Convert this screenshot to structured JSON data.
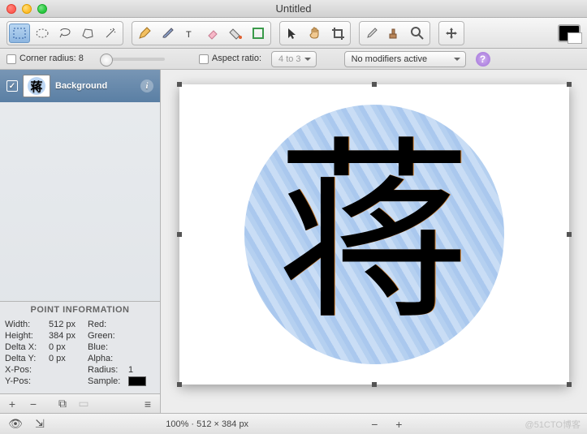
{
  "window": {
    "title": "Untitled"
  },
  "options": {
    "corner_radius_label": "Corner radius:",
    "corner_radius_value": "8",
    "aspect_ratio_label": "Aspect ratio:",
    "aspect_ratio_value": "4 to 3",
    "modifiers_value": "No modifiers active",
    "help_glyph": "?"
  },
  "sidebar": {
    "layer": {
      "name": "Background",
      "thumb_char": "蒋",
      "info_glyph": "i"
    },
    "point_info": {
      "title": "POINT INFORMATION",
      "rows": [
        {
          "k1": "Width:",
          "v1": "512 px",
          "k2": "Red:",
          "v2": ""
        },
        {
          "k1": "Height:",
          "v1": "384 px",
          "k2": "Green:",
          "v2": ""
        },
        {
          "k1": "Delta X:",
          "v1": "0 px",
          "k2": "Blue:",
          "v2": ""
        },
        {
          "k1": "Delta Y:",
          "v1": "0 px",
          "k2": "Alpha:",
          "v2": ""
        },
        {
          "k1": "X-Pos:",
          "v1": "",
          "k2": "Radius:",
          "v2": "1"
        },
        {
          "k1": "Y-Pos:",
          "v1": "",
          "k2": "Sample:",
          "v2": ""
        }
      ]
    }
  },
  "canvas": {
    "glyph": "蒋"
  },
  "status": {
    "zoom_text": "100% · 512 × 384 px",
    "watermark": "@51CTO博客"
  }
}
